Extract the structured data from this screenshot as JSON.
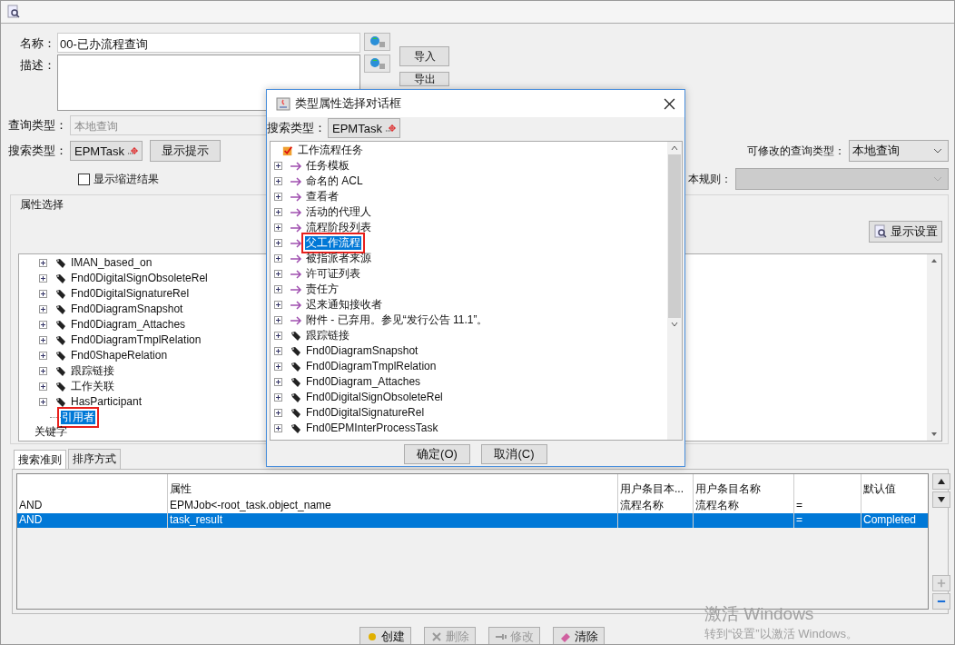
{
  "form": {
    "name_label": "名称：",
    "name_value": "00-已办流程查询",
    "description_label": "描述：",
    "import_button": "导入",
    "export_button": "导出",
    "query_type_label": "查询类型：",
    "query_type_value": "本地查询",
    "search_type_label": "搜索类型：",
    "search_type_value": "EPMTask",
    "hint_button": "显示提示",
    "indent_checkbox": {
      "label": "显示缩进结果",
      "checked": false
    },
    "modifiable_label": "可修改的查询类型：",
    "modifiable_value": "本地查询",
    "revision_rule_label": "本规则："
  },
  "attribute_selection": {
    "title": "属性选择",
    "settings_button": "显示设置",
    "items": [
      {
        "label": "IMAN_based_on",
        "kind": "relation",
        "selected": false,
        "highlighted": false
      },
      {
        "label": "Fnd0DigitalSignObsoleteRel",
        "kind": "relation",
        "selected": false,
        "highlighted": false
      },
      {
        "label": "Fnd0DigitalSignatureRel",
        "kind": "relation",
        "selected": false,
        "highlighted": false
      },
      {
        "label": "Fnd0DiagramSnapshot",
        "kind": "relation",
        "selected": false,
        "highlighted": false
      },
      {
        "label": "Fnd0Diagram_Attaches",
        "kind": "relation",
        "selected": false,
        "highlighted": false
      },
      {
        "label": "Fnd0DiagramTmplRelation",
        "kind": "relation",
        "selected": false,
        "highlighted": false
      },
      {
        "label": "Fnd0ShapeRelation",
        "kind": "relation",
        "selected": false,
        "highlighted": false
      },
      {
        "label": "跟踪链接",
        "kind": "relation",
        "selected": false,
        "highlighted": false
      },
      {
        "label": "工作关联",
        "kind": "relation",
        "selected": false,
        "highlighted": false
      },
      {
        "label": "HasParticipant",
        "kind": "relation",
        "selected": false,
        "highlighted": false
      },
      {
        "label": "引用者",
        "kind": "leaf",
        "selected": true,
        "highlighted": true
      },
      {
        "label": "关键字",
        "kind": "root-leaf",
        "selected": false,
        "highlighted": false
      }
    ]
  },
  "criteria": {
    "tabs": [
      {
        "label": "搜索准则",
        "selected": true
      },
      {
        "label": "排序方式",
        "selected": false
      }
    ],
    "headers": {
      "attribute": "属性",
      "user_entry_l10n": "用户条目本...",
      "user_entry_name": "用户条目名称",
      "default_value": "默认值"
    },
    "rows": [
      {
        "logic": "AND",
        "attribute": "EPMJob<-root_task.object_name",
        "user_entry_l10n": "流程名称",
        "user_entry_name": "流程名称",
        "operator": "=",
        "selected": false
      },
      {
        "logic": "AND",
        "attribute": "task_result",
        "operator": "=",
        "default_value": "Completed",
        "selected": true
      }
    ]
  },
  "actions": [
    {
      "label": "创建",
      "kind": "create",
      "disabled": false
    },
    {
      "label": "删除",
      "kind": "delete",
      "disabled": true
    },
    {
      "label": "修改",
      "kind": "modify",
      "disabled": true
    },
    {
      "label": "清除",
      "kind": "clear",
      "disabled": false
    }
  ],
  "dialog": {
    "title": "类型属性选择对话框",
    "search_type_label": "搜索类型：",
    "search_type_value": "EPMTask",
    "root": "工作流程任务",
    "items": [
      {
        "label": "任务模板",
        "kind": "reference",
        "selected": false,
        "highlighted": false
      },
      {
        "label": "命名的 ACL",
        "kind": "reference",
        "selected": false,
        "highlighted": false
      },
      {
        "label": "查看者",
        "kind": "reference",
        "selected": false,
        "highlighted": false
      },
      {
        "label": "活动的代理人",
        "kind": "reference",
        "selected": false,
        "highlighted": false
      },
      {
        "label": "流程阶段列表",
        "kind": "reference",
        "selected": false,
        "highlighted": false
      },
      {
        "label": "父工作流程",
        "kind": "reference",
        "selected": true,
        "highlighted": true
      },
      {
        "label": "被指派者来源",
        "kind": "reference",
        "selected": false,
        "highlighted": false
      },
      {
        "label": "许可证列表",
        "kind": "reference",
        "selected": false,
        "highlighted": false
      },
      {
        "label": "责任方",
        "kind": "reference",
        "selected": false,
        "highlighted": false
      },
      {
        "label": "迟来通知接收者",
        "kind": "reference",
        "selected": false,
        "highlighted": false
      },
      {
        "label": "附件 - 已弃用。参见“发行公告 11.1”。",
        "kind": "reference",
        "selected": false,
        "highlighted": false
      },
      {
        "label": "跟踪链接",
        "kind": "relation",
        "selected": false,
        "highlighted": false
      },
      {
        "label": "Fnd0DiagramSnapshot",
        "kind": "relation",
        "selected": false,
        "highlighted": false
      },
      {
        "label": "Fnd0DiagramTmplRelation",
        "kind": "relation",
        "selected": false,
        "highlighted": false
      },
      {
        "label": "Fnd0Diagram_Attaches",
        "kind": "relation",
        "selected": false,
        "highlighted": false
      },
      {
        "label": "Fnd0DigitalSignObsoleteRel",
        "kind": "relation",
        "selected": false,
        "highlighted": false
      },
      {
        "label": "Fnd0DigitalSignatureRel",
        "kind": "relation",
        "selected": false,
        "highlighted": false
      },
      {
        "label": "Fnd0EPMInterProcessTask",
        "kind": "relation",
        "selected": false,
        "highlighted": false
      }
    ],
    "ok_button": "确定(O)",
    "cancel_button": "取消(C)"
  },
  "activation_notice": {
    "title": "激活 Windows",
    "text": "转到“设置”以激活 Windows。"
  }
}
